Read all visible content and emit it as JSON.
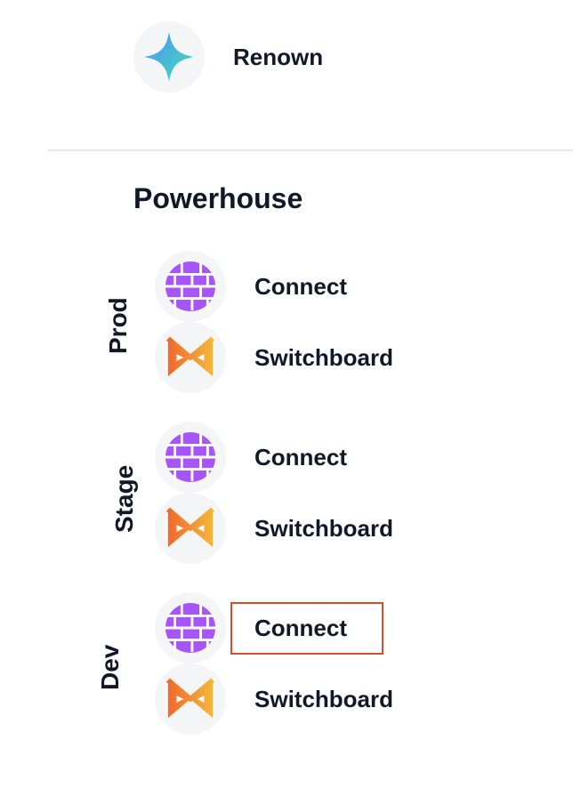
{
  "header": {
    "app_name": "Renown",
    "icon": "renown-sparkle-icon"
  },
  "section": {
    "title": "Powerhouse"
  },
  "environments": [
    {
      "name": "Prod",
      "apps": [
        {
          "label": "Connect",
          "icon": "connect-brick-icon"
        },
        {
          "label": "Switchboard",
          "icon": "switchboard-bowtie-icon"
        }
      ]
    },
    {
      "name": "Stage",
      "apps": [
        {
          "label": "Connect",
          "icon": "connect-brick-icon"
        },
        {
          "label": "Switchboard",
          "icon": "switchboard-bowtie-icon"
        }
      ]
    },
    {
      "name": "Dev",
      "apps": [
        {
          "label": "Connect",
          "icon": "connect-brick-icon",
          "highlighted": true
        },
        {
          "label": "Switchboard",
          "icon": "switchboard-bowtie-icon"
        }
      ]
    }
  ],
  "colors": {
    "connect_purple": "#a855f7",
    "switchboard_orange": "#f97316",
    "highlight_border": "#dc4a2c"
  }
}
